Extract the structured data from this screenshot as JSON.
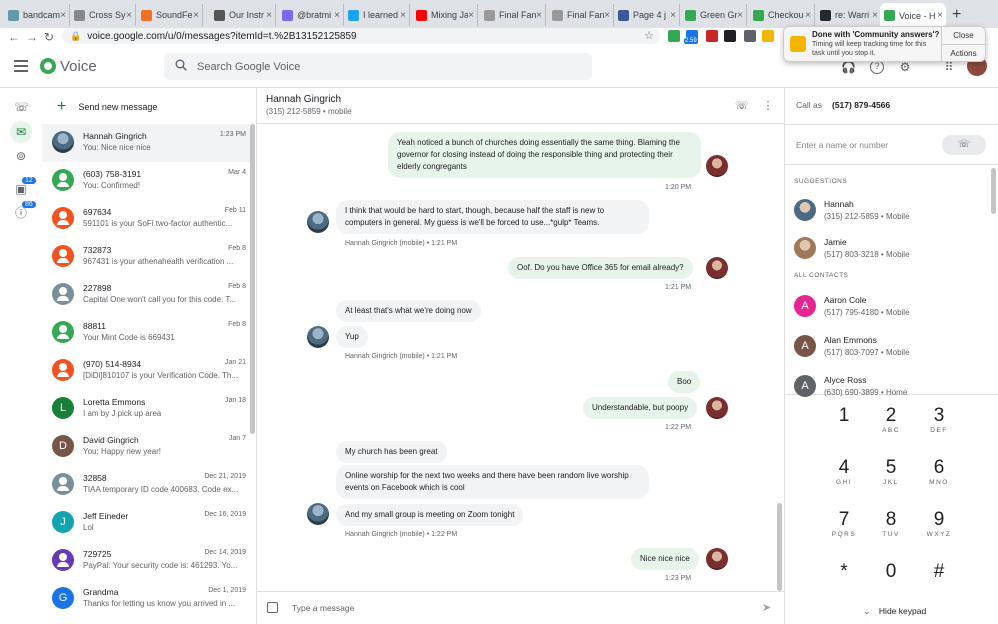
{
  "browser": {
    "tabs": [
      {
        "label": "bandcamp",
        "color": "#629aa9"
      },
      {
        "label": "Cross Sy",
        "color": "#888888"
      },
      {
        "label": "SoundFe",
        "color": "#f26f23"
      },
      {
        "label": "Our Instr",
        "color": "#555555"
      },
      {
        "label": "@bratmi",
        "color": "#7b68ee"
      },
      {
        "label": "I learned",
        "color": "#1da1f2"
      },
      {
        "label": "Mixing Ja",
        "color": "#ff0000"
      },
      {
        "label": "Final Fan",
        "color": "#999999"
      },
      {
        "label": "Final Fan",
        "color": "#999999"
      },
      {
        "label": "Page 4 j",
        "color": "#3b5998"
      },
      {
        "label": "Green Gr",
        "color": "#34a853"
      },
      {
        "label": "Checkou",
        "color": "#34a853"
      },
      {
        "label": "re: Warri",
        "color": "#24292e"
      },
      {
        "label": "Voice - H",
        "color": "#34a853"
      }
    ],
    "url": "voice.google.com/u/0/messages?itemId=t.%2B13152125859",
    "ext_badge": "2.59"
  },
  "notification": {
    "title": "Done with 'Community answers'?",
    "body": "Timing will keep tracking time for this task until you stop it.",
    "close_label": "Close",
    "actions_label": "Actions"
  },
  "app": {
    "name": "Voice",
    "search_placeholder": "Search Google Voice"
  },
  "rail": {
    "badge_calls": "12",
    "badge_vm": "86"
  },
  "conversations": {
    "new_message_label": "Send new message",
    "items": [
      {
        "name": "Hannah Gingrich",
        "date": "1:23 PM",
        "preview": "You: Nice nice nice",
        "avatar": "photo",
        "color": "#4b6b85"
      },
      {
        "name": "(603) 758-3191",
        "date": "Mar 4",
        "preview": "You: Confirmed!",
        "avatar": "person",
        "color": "#34a853"
      },
      {
        "name": "697634",
        "date": "Feb 11",
        "preview": "591101 is your SoFi two-factor authentic...",
        "avatar": "person",
        "color": "#f4511e"
      },
      {
        "name": "732873",
        "date": "Feb 8",
        "preview": "967431 is your athenahealth verification ...",
        "avatar": "person",
        "color": "#f4511e"
      },
      {
        "name": "227898",
        "date": "Feb 8",
        "preview": "Capital One won't call you for this code. T...",
        "avatar": "person",
        "color": "#78909c"
      },
      {
        "name": "88811",
        "date": "Feb 8",
        "preview": "Your Mint Code is 669431",
        "avatar": "person",
        "color": "#34a853"
      },
      {
        "name": "(970) 514-8934",
        "date": "Jan 21",
        "preview": "[DiDi]810107 is your Verification Code. Th...",
        "avatar": "person",
        "color": "#f4511e"
      },
      {
        "name": "Loretta Emmons",
        "date": "Jan 18",
        "preview": "I am by J pick up area",
        "avatar": "L",
        "color": "#188038"
      },
      {
        "name": "David Gingrich",
        "date": "Jan 7",
        "preview": "You: Happy new year!",
        "avatar": "D",
        "color": "#795548"
      },
      {
        "name": "32858",
        "date": "Dec 21, 2019",
        "preview": "TIAA temporary ID code 400683. Code ex...",
        "avatar": "person",
        "color": "#78909c"
      },
      {
        "name": "Jeff Eineder",
        "date": "Dec 16, 2019",
        "preview": "Lol",
        "avatar": "J",
        "color": "#12a4af"
      },
      {
        "name": "729725",
        "date": "Dec 14, 2019",
        "preview": "PayPal: Your security code is: 461293. Yo...",
        "avatar": "person",
        "color": "#673ab7"
      },
      {
        "name": "Grandma",
        "date": "Dec 1, 2019",
        "preview": "Thanks for letting us know you arrived in ...",
        "avatar": "G",
        "color": "#1a73e8"
      }
    ]
  },
  "thread": {
    "name": "Hannah Gingrich",
    "subtitle": "(315) 212-5859 • mobile",
    "messages": [
      {
        "dir": "out",
        "text": "Yeah noticed a bunch of churches doing essentially the same thing. Blaming the governor for closing instead of doing the responsible thing and protecting their elderly congregants",
        "meta": "1:20 PM"
      },
      {
        "dir": "in",
        "text": "I think that would be hard to start, though, because half the staff is new to computers in general. My guess is we'll be forced to use...*gulp* Teams.",
        "meta": "Hannah Gingrich (mobile) • 1:21 PM"
      },
      {
        "dir": "out",
        "text": "Oof. Do you have Office 365 for email already?",
        "meta": "1:21 PM"
      },
      {
        "dir": "in",
        "text": "At least that's what we're doing now"
      },
      {
        "dir": "in",
        "text": "Yup",
        "meta": "Hannah Gingrich (mobile) • 1:21 PM"
      },
      {
        "dir": "out",
        "text": "Boo"
      },
      {
        "dir": "out",
        "text": "Understandable, but poopy",
        "meta": "1:22 PM"
      },
      {
        "dir": "in",
        "text": "My church has been great"
      },
      {
        "dir": "in",
        "text": "Online worship for the next two weeks and there have been random live worship events on Facebook which is cool"
      },
      {
        "dir": "in",
        "text": "And my small group is meeting on Zoom tonight",
        "meta": "Hannah Gingrich (mobile) • 1:22 PM"
      },
      {
        "dir": "out",
        "text": "Nice nice nice",
        "meta": "1:23 PM"
      }
    ],
    "composer_placeholder": "Type a message"
  },
  "right_panel": {
    "call_as_label": "Call as",
    "call_as_number": "(517) 879-4566",
    "input_placeholder": "Enter a name or number",
    "suggestions_label": "SUGGESTIONS",
    "suggestions": [
      {
        "name": "Hannah",
        "detail": "(315) 212-5859 • Mobile",
        "avatar": "",
        "color": "#4b6b85"
      },
      {
        "name": "Jamie",
        "detail": "(517) 803-3218 • Mobile",
        "avatar": "",
        "color": "#a0785a"
      }
    ],
    "all_contacts_label": "ALL CONTACTS",
    "contacts": [
      {
        "name": "Aaron Cole",
        "detail": "(517) 795-4180 • Mobile",
        "avatar": "A",
        "color": "#e52592"
      },
      {
        "name": "Alan Emmons",
        "detail": "(517) 803-7097 • Mobile",
        "avatar": "A",
        "color": "#795548"
      },
      {
        "name": "Alyce Ross",
        "detail": "(630) 690-3899 • Home",
        "avatar": "A",
        "color": "#5f6368"
      }
    ],
    "keypad": [
      {
        "digit": "1",
        "letters": ""
      },
      {
        "digit": "2",
        "letters": "ABC"
      },
      {
        "digit": "3",
        "letters": "DEF"
      },
      {
        "digit": "4",
        "letters": "GHI"
      },
      {
        "digit": "5",
        "letters": "JKL"
      },
      {
        "digit": "6",
        "letters": "MNO"
      },
      {
        "digit": "7",
        "letters": "PQRS"
      },
      {
        "digit": "8",
        "letters": "TUV"
      },
      {
        "digit": "9",
        "letters": "WXYZ"
      },
      {
        "digit": "*",
        "letters": ""
      },
      {
        "digit": "0",
        "letters": ""
      },
      {
        "digit": "#",
        "letters": ""
      }
    ],
    "hide_keypad_label": "Hide keypad"
  }
}
